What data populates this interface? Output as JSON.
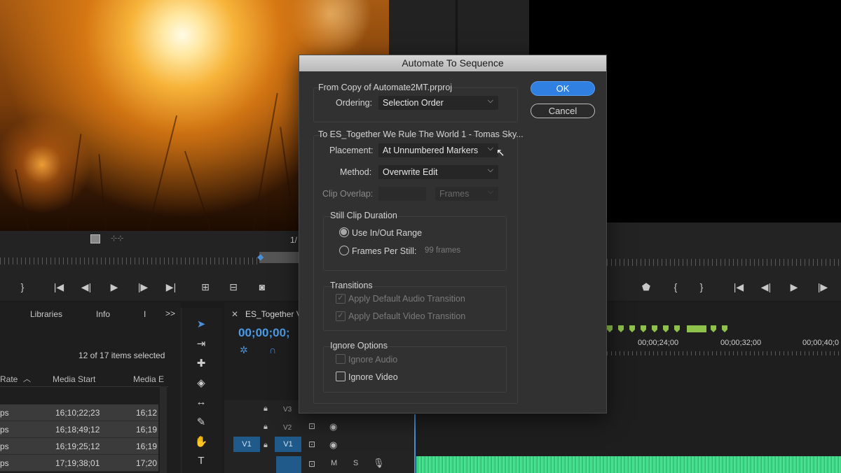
{
  "source_monitor": {
    "page_indicator": "1/"
  },
  "project_panel": {
    "tabs": [
      "Libraries",
      "Info",
      "I"
    ],
    "overflow_label": ">>",
    "selection_status": "12 of 17 items selected",
    "columns": [
      "Rate",
      "Media Start",
      "Media E"
    ],
    "rows": [
      {
        "rate": "ps",
        "media_start": "16;10;22;23",
        "media_end": "16;12"
      },
      {
        "rate": "ps",
        "media_start": "16;18;49;12",
        "media_end": "16;19"
      },
      {
        "rate": "ps",
        "media_start": "16;19;25;12",
        "media_end": "16;19"
      },
      {
        "rate": "ps",
        "media_start": "17;19;38;01",
        "media_end": "17;20"
      }
    ]
  },
  "timeline": {
    "sequence_tab": "ES_Together V",
    "timecode": "00;00;00;",
    "ruler_labels": [
      "00;00;24;00",
      "00;00;32;00",
      "00;00;40;0"
    ],
    "tracks": {
      "v3": "V3",
      "v2": "V2",
      "v1_source": "V1",
      "v1": "V1",
      "audio_mute": "M",
      "audio_solo": "S"
    }
  },
  "dialog": {
    "title": "Automate To Sequence",
    "from_label": "From Copy of Automate2MT.prproj",
    "ordering_label": "Ordering:",
    "ordering_value": "Selection Order",
    "to_label": "To ES_Together We Rule The World 1 - Tomas Sky...",
    "placement_label": "Placement:",
    "placement_value": "At Unnumbered Markers",
    "method_label": "Method:",
    "method_value": "Overwrite Edit",
    "clip_overlap_label": "Clip Overlap:",
    "clip_overlap_unit": "Frames",
    "still_clip_label": "Still Clip Duration",
    "use_inout_label": "Use In/Out Range",
    "frames_per_still_label": "Frames Per Still:",
    "frames_per_still_value": "99 frames",
    "transitions_label": "Transitions",
    "apply_audio_label": "Apply Default Audio Transition",
    "apply_video_label": "Apply Default Video Transition",
    "ignore_options_label": "Ignore Options",
    "ignore_audio_label": "Ignore Audio",
    "ignore_video_label": "Ignore Video",
    "ok_label": "OK",
    "cancel_label": "Cancel",
    "checked_mark": "✓"
  }
}
